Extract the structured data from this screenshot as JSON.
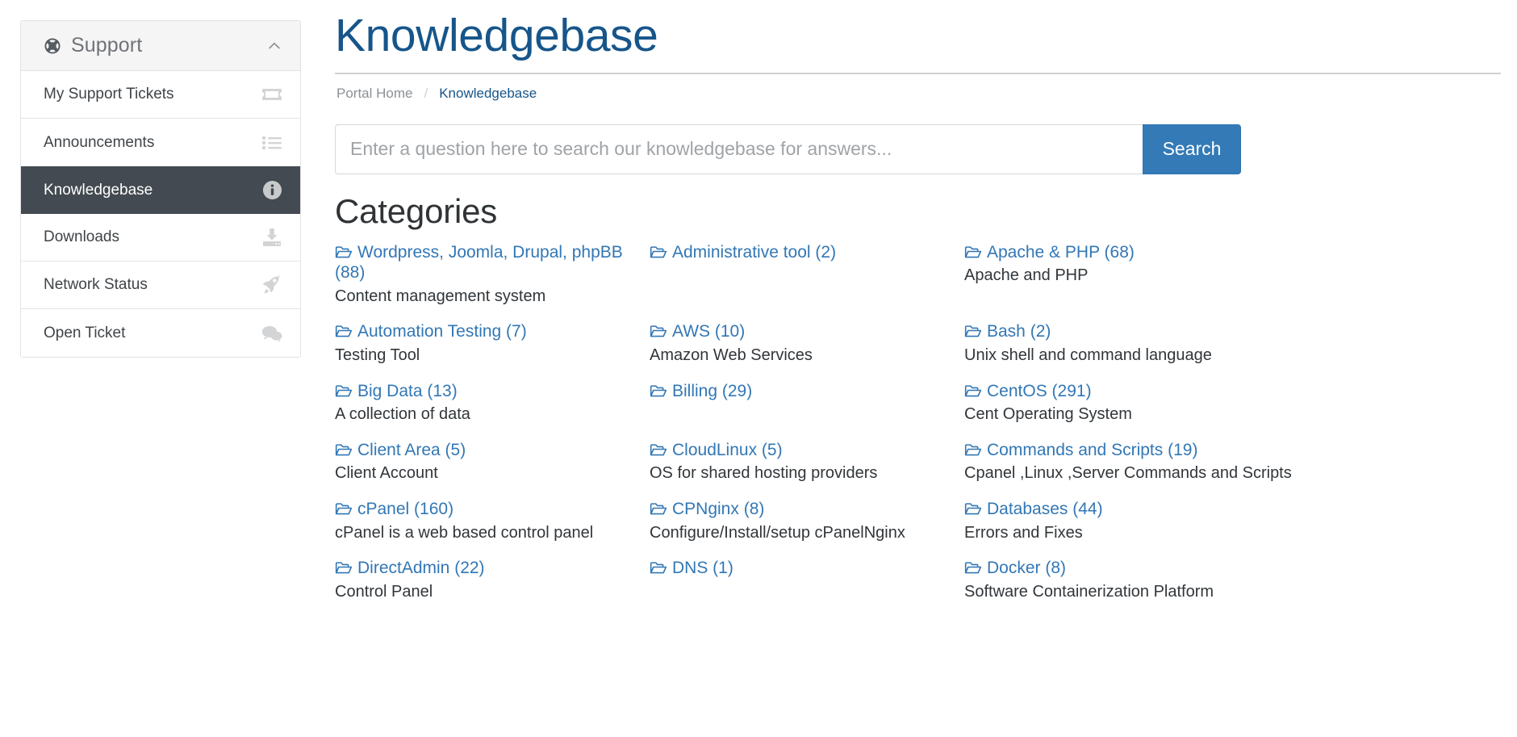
{
  "sidebar": {
    "header": {
      "title": "Support",
      "icon": "life-ring-icon",
      "caret": "chevron-up-icon"
    },
    "items": [
      {
        "label": "My Support Tickets",
        "icon": "ticket-icon",
        "active": false,
        "rule": true
      },
      {
        "label": "Announcements",
        "icon": "list-ul-icon",
        "active": false,
        "rule": false
      },
      {
        "label": "Knowledgebase",
        "icon": "info-circle-icon",
        "active": true,
        "rule": false
      },
      {
        "label": "Downloads",
        "icon": "download-inbox-icon",
        "active": false,
        "rule": true
      },
      {
        "label": "Network Status",
        "icon": "rocket-icon",
        "active": false,
        "rule": true
      },
      {
        "label": "Open Ticket",
        "icon": "comments-icon",
        "active": false,
        "rule": false
      }
    ]
  },
  "header": {
    "title": "Knowledgebase",
    "title_color": "#16558a"
  },
  "breadcrumb": {
    "home": "Portal Home",
    "separator": "/",
    "current": "Knowledgebase"
  },
  "search": {
    "placeholder": "Enter a question here to search our knowledgebase for answers...",
    "value": "",
    "button_label": "Search",
    "button_color": "#337ab7"
  },
  "categories_section": {
    "heading": "Categories",
    "link_color": "#3277b5",
    "items": [
      {
        "name": "Wordpress, Joomla, Drupal, phpBB (88)",
        "desc": "Content management system"
      },
      {
        "name": "Administrative tool (2)",
        "desc": ""
      },
      {
        "name": "Apache & PHP (68)",
        "desc": "Apache and PHP"
      },
      {
        "name": "Automation Testing (7)",
        "desc": "Testing Tool"
      },
      {
        "name": "AWS (10)",
        "desc": "Amazon Web Services"
      },
      {
        "name": "Bash (2)",
        "desc": "Unix shell and command language"
      },
      {
        "name": "Big Data (13)",
        "desc": "A collection of data"
      },
      {
        "name": "Billing (29)",
        "desc": ""
      },
      {
        "name": "CentOS (291)",
        "desc": "Cent Operating System"
      },
      {
        "name": "Client Area (5)",
        "desc": "Client Account"
      },
      {
        "name": "CloudLinux (5)",
        "desc": "OS for shared hosting providers"
      },
      {
        "name": "Commands and Scripts (19)",
        "desc": "Cpanel ,Linux ,Server Commands and Scripts"
      },
      {
        "name": "cPanel (160)",
        "desc": "cPanel is a web based control panel"
      },
      {
        "name": "CPNginx (8)",
        "desc": "Configure/Install/setup cPanelNginx"
      },
      {
        "name": "Databases (44)",
        "desc": "Errors and Fixes"
      },
      {
        "name": "DirectAdmin (22)",
        "desc": "Control Panel"
      },
      {
        "name": "DNS (1)",
        "desc": ""
      },
      {
        "name": "Docker (8)",
        "desc": "Software Containerization Platform"
      }
    ]
  }
}
